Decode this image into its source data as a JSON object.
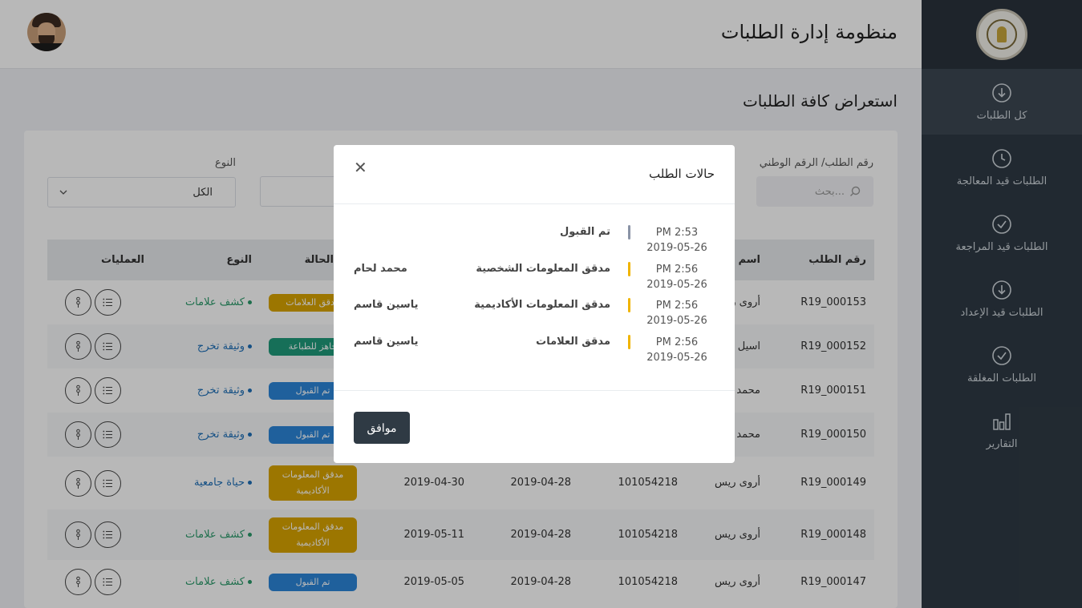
{
  "header": {
    "title": "منظومة إدارة الطلبات"
  },
  "page_title": "استعراض كافة الطلبات",
  "sidebar": {
    "items": [
      {
        "label": "كل الطلبات",
        "icon": "download-circle-icon",
        "active": true
      },
      {
        "label": "الطلبات قيد المعالجة",
        "icon": "clock-icon"
      },
      {
        "label": "الطلبات قيد المراجعة",
        "icon": "check-circle-icon"
      },
      {
        "label": "الطلبات قيد الإعداد",
        "icon": "download-circle-icon"
      },
      {
        "label": "الطلبات المغلقة",
        "icon": "check-circle-icon"
      },
      {
        "label": "التقارير",
        "icon": "bar-chart-icon"
      }
    ]
  },
  "filters": {
    "search_label": "رقم الطلب/ الرقم الوطني",
    "search_placeholder": "بحث...",
    "type_label": "النوع",
    "type_value": "الكل"
  },
  "table": {
    "headers": {
      "request_no": "رقم الطلب",
      "name": "اسم ا",
      "status": "الحالة",
      "type": "النوع",
      "ops": "العمليات"
    },
    "rows": [
      {
        "no": "R19_000153",
        "name": "أروى ر",
        "national": "",
        "date1": "",
        "date2": "",
        "status": "مدقق العلامات",
        "status_color": "#d9a400",
        "type": "كشف علامات",
        "type_color": "#2a9a6a"
      },
      {
        "no": "R19_000152",
        "name": "اسيل ع",
        "national": "",
        "date1": "",
        "date2": "",
        "status": "جاهز للطباعة",
        "status_color": "#1f9a7a",
        "type": "وثيقة تخرج",
        "type_color": "#1e6fb8"
      },
      {
        "no": "R19_000151",
        "name": "محمد",
        "national": "",
        "date1": "",
        "date2": "",
        "status": "تم القبول",
        "status_color": "#2b86d9",
        "type": "وثيقة تخرج",
        "type_color": "#1e6fb8"
      },
      {
        "no": "R19_000150",
        "name": "محمد",
        "national": "",
        "date1": "",
        "date2": "",
        "status": "تم القبول",
        "status_color": "#2b86d9",
        "type": "وثيقة تخرج",
        "type_color": "#1e6fb8"
      },
      {
        "no": "R19_000149",
        "name": "أروى ريس",
        "national": "101054218",
        "date1": "2019-04-28",
        "date2": "2019-04-30",
        "status": "مدقق المعلومات الأكاديمية",
        "status_color": "#d9a400",
        "type": "حياة جامعية",
        "type_color": "#1e6fb8"
      },
      {
        "no": "R19_000148",
        "name": "أروى ريس",
        "national": "101054218",
        "date1": "2019-04-28",
        "date2": "2019-05-11",
        "status": "مدقق المعلومات الأكاديمية",
        "status_color": "#d9a400",
        "type": "كشف علامات",
        "type_color": "#2a9a6a"
      },
      {
        "no": "R19_000147",
        "name": "أروى ريس",
        "national": "101054218",
        "date1": "2019-04-28",
        "date2": "2019-05-05",
        "status": "تم القبول",
        "status_color": "#2b86d9",
        "type": "كشف علامات",
        "type_color": "#2a9a6a"
      }
    ]
  },
  "modal": {
    "title": "حالات الطلب",
    "close_glyph": "✕",
    "ok_label": "موافق",
    "entries": [
      {
        "time": "PM 2:53",
        "date": "2019-05-26",
        "status": "تم القبول",
        "user": "",
        "bar_color": "#8a93a6"
      },
      {
        "time": "PM 2:56",
        "date": "2019-05-26",
        "status": "مدقق المعلومات الشخصية",
        "user": "محمد لحام",
        "bar_color": "#f0b400"
      },
      {
        "time": "PM 2:56",
        "date": "2019-05-26",
        "status": "مدقق المعلومات الأكاديمية",
        "user": "ياسين قاسم",
        "bar_color": "#f0b400"
      },
      {
        "time": "PM 2:56",
        "date": "2019-05-26",
        "status": "مدقق العلامات",
        "user": "ياسين قاسم",
        "bar_color": "#f0b400"
      }
    ]
  }
}
